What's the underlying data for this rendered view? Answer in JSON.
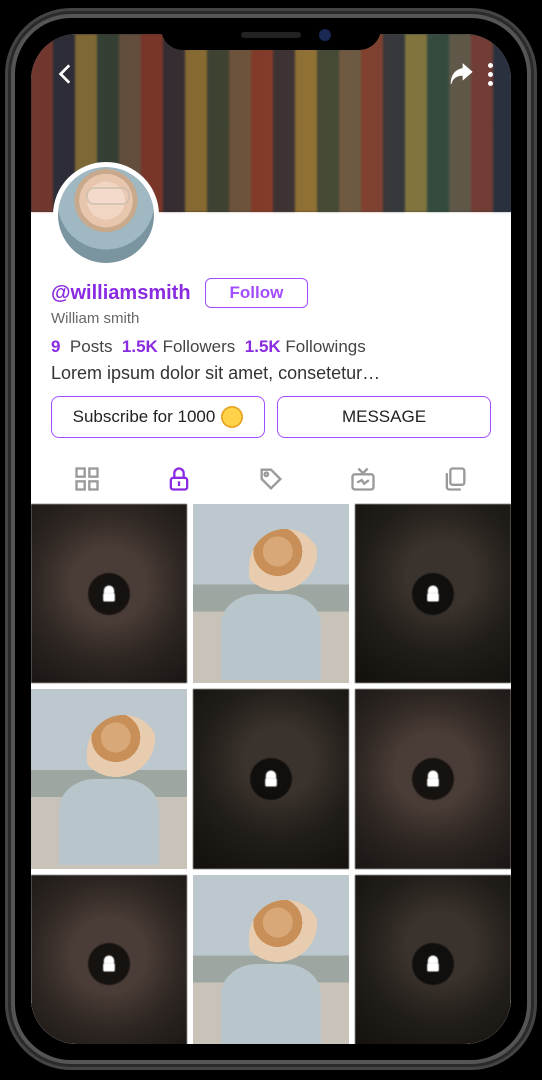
{
  "topbar": {
    "back_icon": "chevron-left",
    "share_icon": "share",
    "menu_icon": "more-vertical"
  },
  "profile": {
    "handle": "@williamsmith",
    "display_name": "William smith",
    "follow_label": "Follow",
    "bio": "Lorem ipsum dolor sit amet, consetetur…"
  },
  "stats": {
    "posts_count": "9",
    "posts_label": "Posts",
    "followers_count": "1.5K",
    "followers_label": "Followers",
    "followings_count": "1.5K",
    "followings_label": "Followings"
  },
  "actions": {
    "subscribe_label": "Subscribe for 1000",
    "message_label": "MESSAGE"
  },
  "tabs": {
    "grid": "grid",
    "locked": "lock",
    "tag": "tag",
    "tv": "tv",
    "multi": "copy",
    "active": "locked"
  },
  "grid_items": [
    {
      "type": "locked"
    },
    {
      "type": "photo"
    },
    {
      "type": "locked_dark"
    },
    {
      "type": "photo"
    },
    {
      "type": "locked_dark"
    },
    {
      "type": "locked"
    },
    {
      "type": "locked"
    },
    {
      "type": "photo"
    },
    {
      "type": "locked_dark"
    }
  ]
}
